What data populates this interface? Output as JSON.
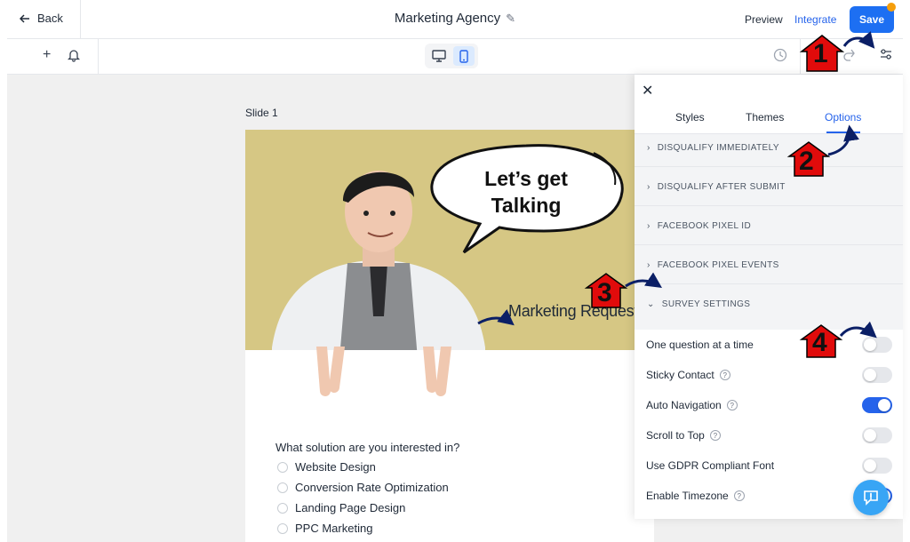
{
  "header": {
    "back_label": "Back",
    "title": "Marketing Agency",
    "preview_label": "Preview",
    "integrate_label": "Integrate",
    "save_label": "Save"
  },
  "canvas": {
    "slide_label": "Slide 1",
    "bubble_line1": "Let’s get",
    "bubble_line2": "Talking",
    "hero_caption": "Marketing Request?",
    "question": "What solution are you interested in?",
    "options": [
      "Website Design",
      "Conversion Rate Optimization",
      "Landing Page Design",
      "PPC Marketing"
    ]
  },
  "panel": {
    "tabs": [
      "Styles",
      "Themes",
      "Options"
    ],
    "active_tab": "Options",
    "accordions": [
      "DISQUALIFY IMMEDIATELY",
      "DISQUALIFY AFTER SUBMIT",
      "FACEBOOK PIXEL ID",
      "FACEBOOK PIXEL EVENTS",
      "SURVEY SETTINGS"
    ],
    "settings": [
      {
        "label": "One question at a time",
        "help": false,
        "enabled": false
      },
      {
        "label": "Sticky Contact",
        "help": true,
        "enabled": false
      },
      {
        "label": "Auto Navigation",
        "help": true,
        "enabled": true
      },
      {
        "label": "Scroll to Top",
        "help": true,
        "enabled": false
      },
      {
        "label": "Use GDPR Compliant Font",
        "help": false,
        "enabled": false
      },
      {
        "label": "Enable Timezone",
        "help": true,
        "enabled": true
      }
    ]
  },
  "steps": [
    "1",
    "2",
    "3",
    "4"
  ],
  "colors": {
    "accent": "#2563eb",
    "save": "#1d6ff2",
    "hero_bg": "#d6c784",
    "marker": "#e10b0b",
    "arrow": "#0b1f66"
  }
}
